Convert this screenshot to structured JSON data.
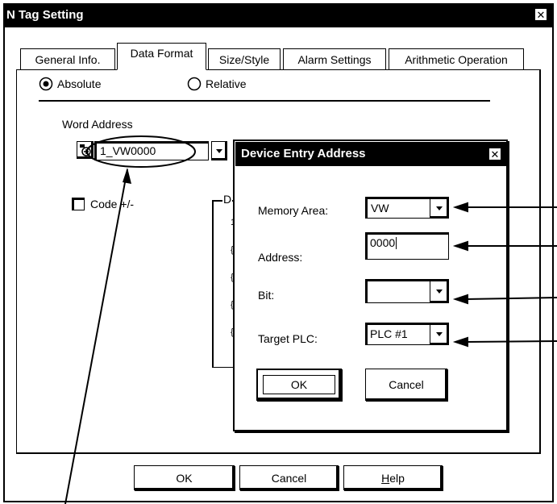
{
  "main_window": {
    "title": "N Tag Setting",
    "close_glyph": "✕",
    "tabs": [
      {
        "label": "General Info.",
        "active": false
      },
      {
        "label": "Data Format",
        "active": true
      },
      {
        "label": "Size/Style",
        "active": false
      },
      {
        "label": "Alarm Settings",
        "active": false
      },
      {
        "label": "Arithmetic Operation",
        "active": false
      }
    ],
    "address_mode": {
      "options": [
        "Absolute",
        "Relative"
      ],
      "selected": "Absolute"
    },
    "word_address": {
      "label": "Word Address",
      "value": "1_VW0000"
    },
    "code_checkbox": {
      "label": "Code +/-",
      "checked": false
    },
    "group_partial_label": "D",
    "buttons": {
      "ok": "OK",
      "cancel": "Cancel",
      "help_prefix": "",
      "help_underlined": "H",
      "help_rest": "elp"
    }
  },
  "device_dialog": {
    "title": "Device Entry Address",
    "close_glyph": "✕",
    "memory_area": {
      "label": "Memory Area:",
      "value": "VW"
    },
    "address": {
      "label": "Address:",
      "value": "0000"
    },
    "bit": {
      "label": "Bit:",
      "value": ""
    },
    "target_plc": {
      "label": "Target PLC:",
      "value": "PLC #1"
    },
    "buttons": {
      "ok": "OK",
      "cancel": "Cancel"
    }
  },
  "colors": {
    "foreground": "#000000",
    "background": "#ffffff"
  }
}
